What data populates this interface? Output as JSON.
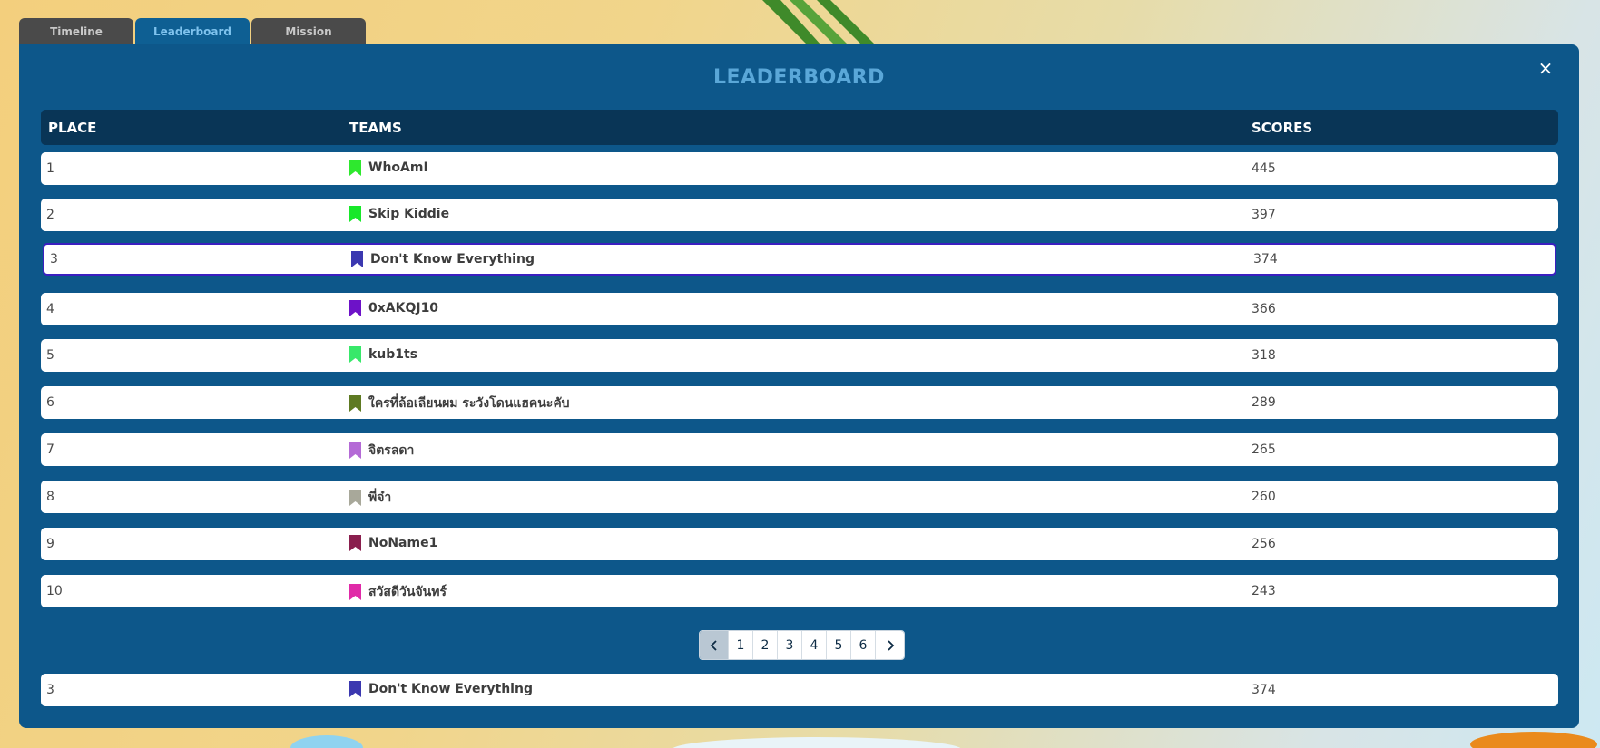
{
  "tabs": [
    "Timeline",
    "Leaderboard",
    "Mission"
  ],
  "active_tab": "Leaderboard",
  "title": "LEADERBOARD",
  "close_label": "×",
  "headers": {
    "place": "PLACE",
    "teams": "TEAMS",
    "scores": "SCORES"
  },
  "rows": [
    {
      "place": "1",
      "team": "WhoAmI",
      "score": "445",
      "flag_color": "#2ee82e"
    },
    {
      "place": "2",
      "team": "Skip Kiddie",
      "score": "397",
      "flag_color": "#18e82a"
    },
    {
      "place": "3",
      "team": "Don't Know Everything",
      "score": "374",
      "flag_color": "#3b38b0"
    },
    {
      "place": "4",
      "team": "0xAKQJ10",
      "score": "366",
      "flag_color": "#6d12c8"
    },
    {
      "place": "5",
      "team": "kub1ts",
      "score": "318",
      "flag_color": "#38e86a"
    },
    {
      "place": "6",
      "team": "ใครที่ล้อเลียนผม ระวังโดนแฮคนะคับ",
      "score": "289",
      "flag_color": "#5e7a22"
    },
    {
      "place": "7",
      "team": "จิตรลดา",
      "score": "265",
      "flag_color": "#b46ad6"
    },
    {
      "place": "8",
      "team": "พี่จ๋า",
      "score": "260",
      "flag_color": "#a8a89a"
    },
    {
      "place": "9",
      "team": "NoName1",
      "score": "256",
      "flag_color": "#8a1f4e"
    },
    {
      "place": "10",
      "team": "สวัสดีวันจันทร์",
      "score": "243",
      "flag_color": "#e02aa8"
    }
  ],
  "highlight_place": "3",
  "pagination": {
    "prev": "‹",
    "pages": [
      "1",
      "2",
      "3",
      "4",
      "5",
      "6"
    ],
    "next": "›",
    "current": "1"
  },
  "my_team": {
    "place": "3",
    "team": "Don't Know Everything",
    "score": "374",
    "flag_color": "#3b38b0"
  }
}
